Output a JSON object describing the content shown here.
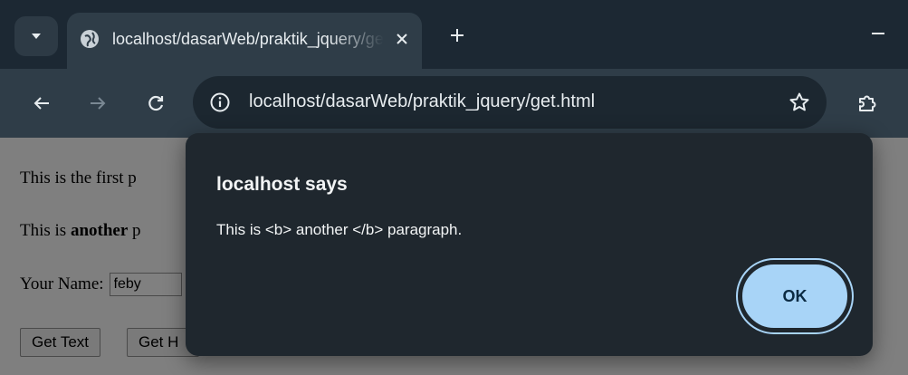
{
  "browser": {
    "tab": {
      "title": "localhost/dasarWeb/praktik_jquery/get.html"
    },
    "address_bar": {
      "url": "localhost/dasarWeb/praktik_jquery/get.html"
    },
    "icons": {
      "tab_search": "chevron-down-icon",
      "favicon": "globe-icon",
      "tab_close": "close-icon",
      "new_tab": "plus-icon",
      "minimize": "minimize-icon",
      "back": "arrow-left-icon",
      "forward": "arrow-right-icon",
      "reload": "reload-icon",
      "site_info": "info-icon",
      "bookmark": "star-icon",
      "extensions": "puzzle-icon"
    },
    "colors": {
      "tabstrip": "#1c2833",
      "toolbar": "#2f3d48",
      "omnibox": "#1c2730",
      "accent": "#a8d4f7"
    }
  },
  "page": {
    "paragraph1": "This is the first p",
    "paragraph2_prefix": "This is ",
    "paragraph2_bold": "another",
    "paragraph2_suffix": " p",
    "name_label": "Your Name:",
    "name_value": "feby",
    "btn_get_text": "Get Text",
    "btn_get_html": "Get H"
  },
  "dialog": {
    "title": "localhost says",
    "message": "This is <b> another </b> paragraph.",
    "ok_label": "OK"
  }
}
